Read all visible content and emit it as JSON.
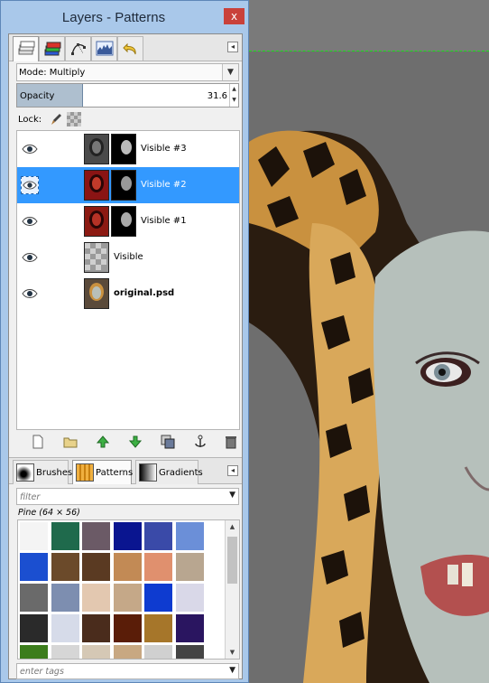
{
  "window": {
    "title": "Layers - Patterns",
    "close_glyph": "x"
  },
  "top_tabs": [
    {
      "name": "layers",
      "icon": "layers-icon"
    },
    {
      "name": "channels",
      "icon": "channels-icon"
    },
    {
      "name": "paths",
      "icon": "paths-icon"
    },
    {
      "name": "histogram",
      "icon": "histogram-icon"
    },
    {
      "name": "undo-history",
      "icon": "undo-icon"
    }
  ],
  "mode": {
    "label": "Mode: Multiply"
  },
  "opacity": {
    "label": "Opacity",
    "value": "31.6"
  },
  "lock": {
    "label": "Lock:"
  },
  "layers": [
    {
      "name": "Visible #3",
      "selected": false,
      "has_mask": true,
      "bold": false
    },
    {
      "name": "Visible #2",
      "selected": true,
      "has_mask": true,
      "bold": false
    },
    {
      "name": "Visible #1",
      "selected": false,
      "has_mask": true,
      "bold": false
    },
    {
      "name": "Visible",
      "selected": false,
      "has_mask": false,
      "bold": false
    },
    {
      "name": "original.psd",
      "selected": false,
      "has_mask": false,
      "bold": true
    }
  ],
  "bottom_tabs": [
    {
      "label": "Brushes",
      "active": false
    },
    {
      "label": "Patterns",
      "active": true
    },
    {
      "label": "Gradients",
      "active": false
    }
  ],
  "filter": {
    "placeholder": "filter"
  },
  "pattern_info": {
    "name": "Pine (64 × 56)"
  },
  "tags": {
    "placeholder": "enter tags"
  },
  "patterns": [
    "#f4f4f4",
    "#1f6a4c",
    "#6b5a66",
    "#0a1590",
    "#3a4aa8",
    "#6b8fd8",
    "#1b4fd0",
    "#6b4a2a",
    "#5a3a22",
    "#c28a55",
    "#e0906e",
    "#b8a690",
    "#6a6a6a",
    "#7d8eb0",
    "#e3c8b0",
    "#c5a888",
    "#0e3bd0",
    "#d9d8e8",
    "#2a2a2a",
    "#d6dbe9",
    "#4a2c1c",
    "#5a1d08",
    "#a6762a",
    "#2a1560",
    "#3c7d1c",
    "#d6d6d6",
    "#d5c8b5",
    "#c8a882",
    "#d0d0d0",
    "#444444"
  ],
  "colors": {
    "selection": "#3399ff",
    "window": "#a9c8ea",
    "close": "#c9413a",
    "guide": "#19e019"
  }
}
